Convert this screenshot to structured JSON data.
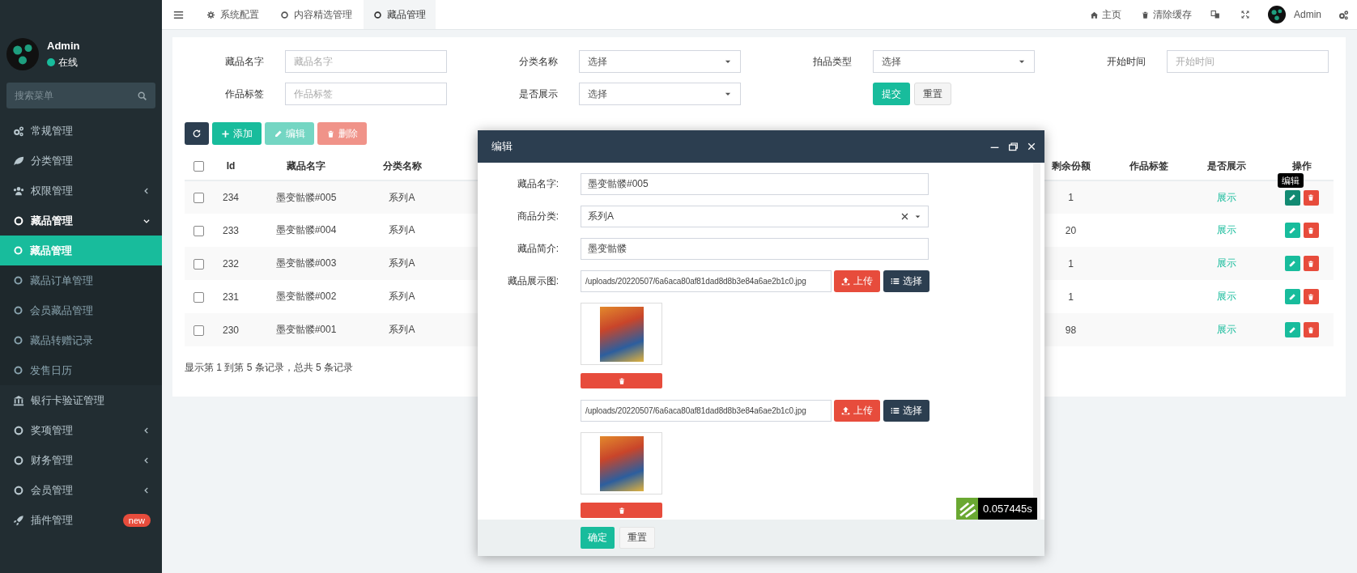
{
  "sidebar": {
    "user": {
      "name": "Admin",
      "status": "在线"
    },
    "search": {
      "placeholder": "搜索菜单"
    },
    "items": [
      {
        "label": "常规管理",
        "kind": "link",
        "selected": false
      },
      {
        "label": "分类管理",
        "kind": "link",
        "selected": false
      },
      {
        "label": "权限管理",
        "kind": "group",
        "expanded": false,
        "selected": false
      },
      {
        "label": "藏品管理",
        "kind": "group",
        "expanded": true,
        "selected": false,
        "children": [
          {
            "label": "藏品管理",
            "selected": true
          },
          {
            "label": "藏品订单管理",
            "selected": false
          },
          {
            "label": "会员藏品管理",
            "selected": false
          },
          {
            "label": "藏品转赠记录",
            "selected": false
          },
          {
            "label": "发售日历",
            "selected": false
          }
        ]
      },
      {
        "label": "银行卡验证管理",
        "kind": "link",
        "selected": false
      },
      {
        "label": "奖项管理",
        "kind": "group",
        "expanded": false,
        "selected": false
      },
      {
        "label": "财务管理",
        "kind": "group",
        "expanded": false,
        "selected": false
      },
      {
        "label": "会员管理",
        "kind": "group",
        "expanded": false,
        "selected": false
      },
      {
        "label": "插件管理",
        "kind": "link",
        "selected": false,
        "badge": "new"
      }
    ]
  },
  "header": {
    "tabs": [
      {
        "label": "系统配置",
        "selected": false
      },
      {
        "label": "内容精选管理",
        "selected": false
      },
      {
        "label": "藏品管理",
        "selected": true
      }
    ],
    "links": [
      {
        "label": "主页"
      },
      {
        "label": "清除缓存"
      }
    ],
    "user": {
      "name": "Admin"
    }
  },
  "filters": {
    "fields": [
      {
        "label": "藏品名字",
        "kind": "input",
        "placeholder": "藏品名字"
      },
      {
        "label": "分类名称",
        "kind": "select",
        "value": "选择"
      },
      {
        "label": "拍品类型",
        "kind": "select",
        "value": "选择"
      },
      {
        "label": "开始时间",
        "kind": "input",
        "placeholder": "开始时间"
      },
      {
        "label": "作品标签",
        "kind": "input",
        "placeholder": "作品标签"
      },
      {
        "label": "是否展示",
        "kind": "select",
        "value": "选择"
      }
    ],
    "buttons": [
      {
        "label": "提交",
        "kind": "primary"
      },
      {
        "label": "重置",
        "kind": "default"
      }
    ]
  },
  "toolbar": {
    "buttons": [
      {
        "label": "添加",
        "kind": "add",
        "disabled": false
      },
      {
        "label": "编辑",
        "kind": "edit",
        "disabled": true
      },
      {
        "label": "删除",
        "kind": "delete",
        "disabled": true
      }
    ]
  },
  "table": {
    "select_all": {
      "checked": false
    },
    "columns": [
      {
        "label": "Id"
      },
      {
        "label": "藏品名字"
      },
      {
        "label": "分类名称"
      },
      {
        "label": "剩余份额"
      },
      {
        "label": "作品标签"
      },
      {
        "label": "是否展示"
      },
      {
        "label": "操作"
      }
    ],
    "tooltip": "编辑",
    "rows": [
      {
        "checked": false,
        "id": "234",
        "name": "墨变骷髅#005",
        "category": "系列A",
        "remaining": "1",
        "display": "展示",
        "edit_hover": true
      },
      {
        "checked": false,
        "id": "233",
        "name": "墨变骷髅#004",
        "category": "系列A",
        "remaining": "20",
        "display": "展示",
        "edit_hover": false
      },
      {
        "checked": false,
        "id": "232",
        "name": "墨变骷髅#003",
        "category": "系列A",
        "remaining": "1",
        "display": "展示",
        "edit_hover": false
      },
      {
        "checked": false,
        "id": "231",
        "name": "墨变骷髅#002",
        "category": "系列A",
        "remaining": "1",
        "display": "展示",
        "edit_hover": false
      },
      {
        "checked": false,
        "id": "230",
        "name": "墨变骷髅#001",
        "category": "系列A",
        "remaining": "98",
        "display": "展示",
        "edit_hover": false
      }
    ],
    "pagination": "显示第 1 到第 5 条记录，总共 5 条记录"
  },
  "modal": {
    "title": "编辑",
    "fields": [
      {
        "kind": "input",
        "label": "藏品名字:",
        "value": "墨变骷髅#005"
      },
      {
        "kind": "select",
        "label": "商品分类:",
        "value": "系列A"
      },
      {
        "kind": "input",
        "label": "藏品简介:",
        "value": "墨变骷髅"
      },
      {
        "kind": "image",
        "label": "藏品展示图:",
        "value": "/uploads/20220507/6a6aca80af81dad8d8b3e84a6ae2b1c0.jpg",
        "buttons": [
          "上传",
          "选择"
        ]
      },
      {
        "kind": "image",
        "value": "/uploads/20220507/6a6aca80af81dad8d8b3e84a6ae2b1c0.jpg",
        "buttons": [
          "上传",
          "选择"
        ]
      }
    ],
    "buttons": [
      {
        "label": "确定",
        "kind": "primary"
      },
      {
        "label": "重置",
        "kind": "default"
      }
    ]
  },
  "debug": {
    "time": "0.057445s"
  }
}
